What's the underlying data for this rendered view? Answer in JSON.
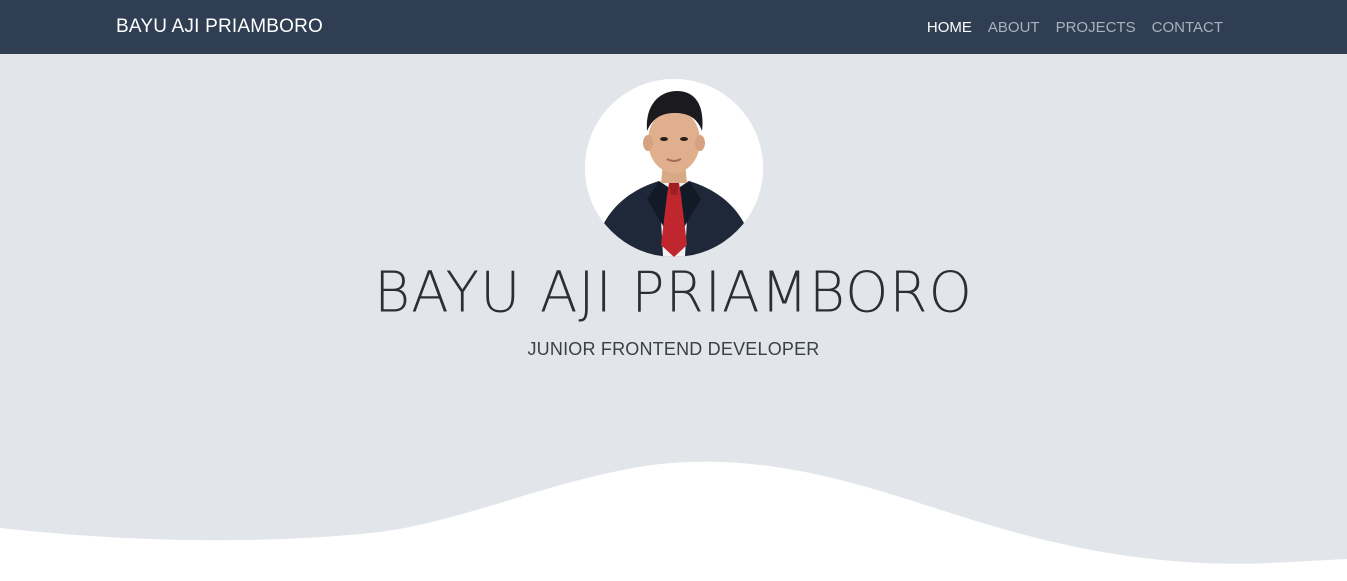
{
  "nav": {
    "brand": "BAYU AJI PRIAMBORO",
    "items": [
      {
        "label": "HOME",
        "active": true
      },
      {
        "label": "ABOUT",
        "active": false
      },
      {
        "label": "PROJECTS",
        "active": false
      },
      {
        "label": "CONTACT",
        "active": false
      }
    ]
  },
  "hero": {
    "name": "BAYU AJI PRIAMBORO",
    "title": "JUNIOR FRONTEND DEVELOPER"
  },
  "colors": {
    "navbar": "#2f3e53",
    "hero_bg": "#e2e5ea",
    "text": "#2a2e36",
    "active_link": "#ffffff",
    "inactive_link": "#a9b2bd"
  }
}
